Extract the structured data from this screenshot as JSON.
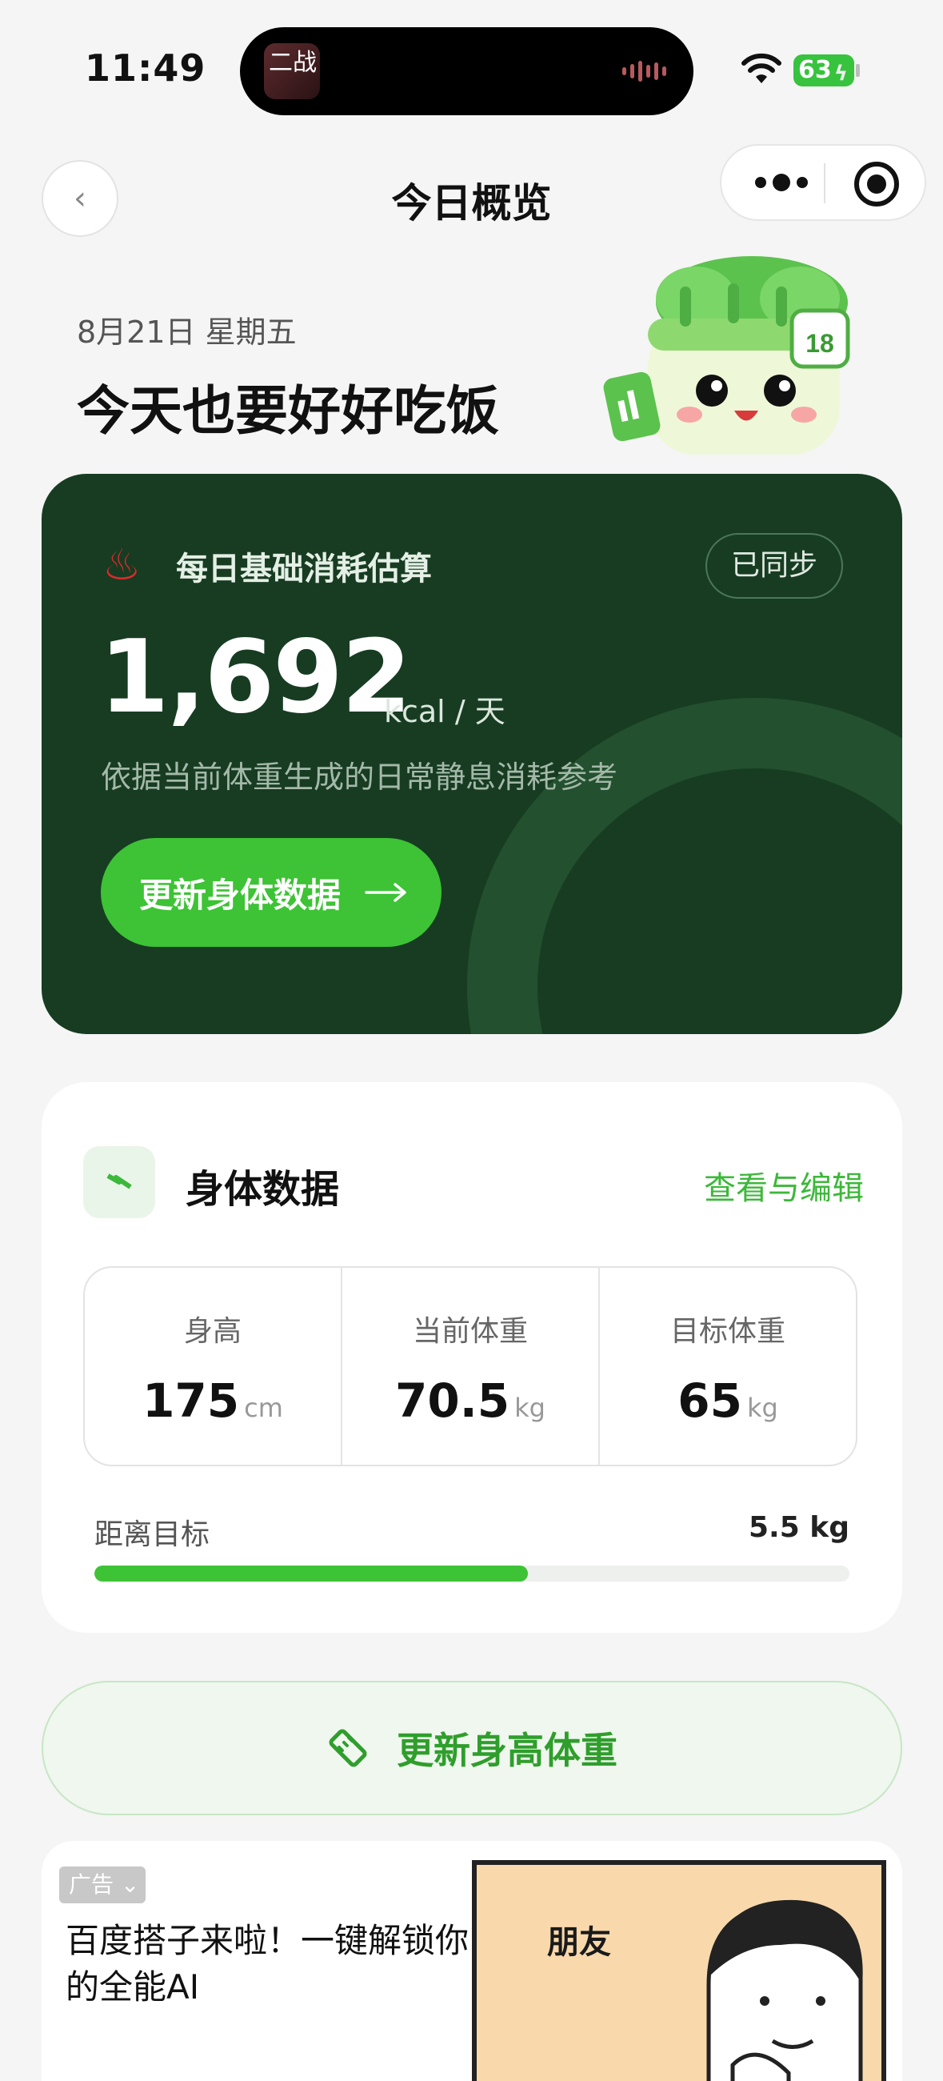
{
  "status_bar": {
    "time": "11:49",
    "battery": "63",
    "island_app": "二战"
  },
  "nav": {
    "title": "今日概览"
  },
  "header": {
    "date": "8月21日 星期五",
    "greeting": "今天也要好好吃饭",
    "mascot_badge": "18"
  },
  "bmr_card": {
    "title": "每日基础消耗估算",
    "sync_status": "已同步",
    "value": "1,692",
    "unit": "kcal / 天",
    "description": "依据当前体重生成的日常静息消耗参考",
    "button_label": "更新身体数据"
  },
  "body_data": {
    "title": "身体数据",
    "edit_link": "查看与编辑",
    "metrics": [
      {
        "label": "身高",
        "value": "175",
        "unit": "cm"
      },
      {
        "label": "当前体重",
        "value": "70.5",
        "unit": "kg"
      },
      {
        "label": "目标体重",
        "value": "65",
        "unit": "kg"
      }
    ],
    "distance_label": "距离目标",
    "distance_value": "5.5 kg",
    "progress_fraction": 0.574
  },
  "update_button": {
    "label": "更新身高体重"
  },
  "ad": {
    "tag": "广告",
    "text": "百度搭子来啦！一键解锁你的全能AI",
    "image_text": "朋友"
  },
  "colors": {
    "brand_green": "#3dc335",
    "hero_bg": "#173c22",
    "accent_text": "#2f9e2c"
  },
  "icons": [
    "wifi-icon",
    "back-icon",
    "more-icon",
    "target-icon",
    "flame-icon",
    "arrow-right-icon",
    "bolt-icon",
    "ruler-icon",
    "chevron-down-icon"
  ]
}
